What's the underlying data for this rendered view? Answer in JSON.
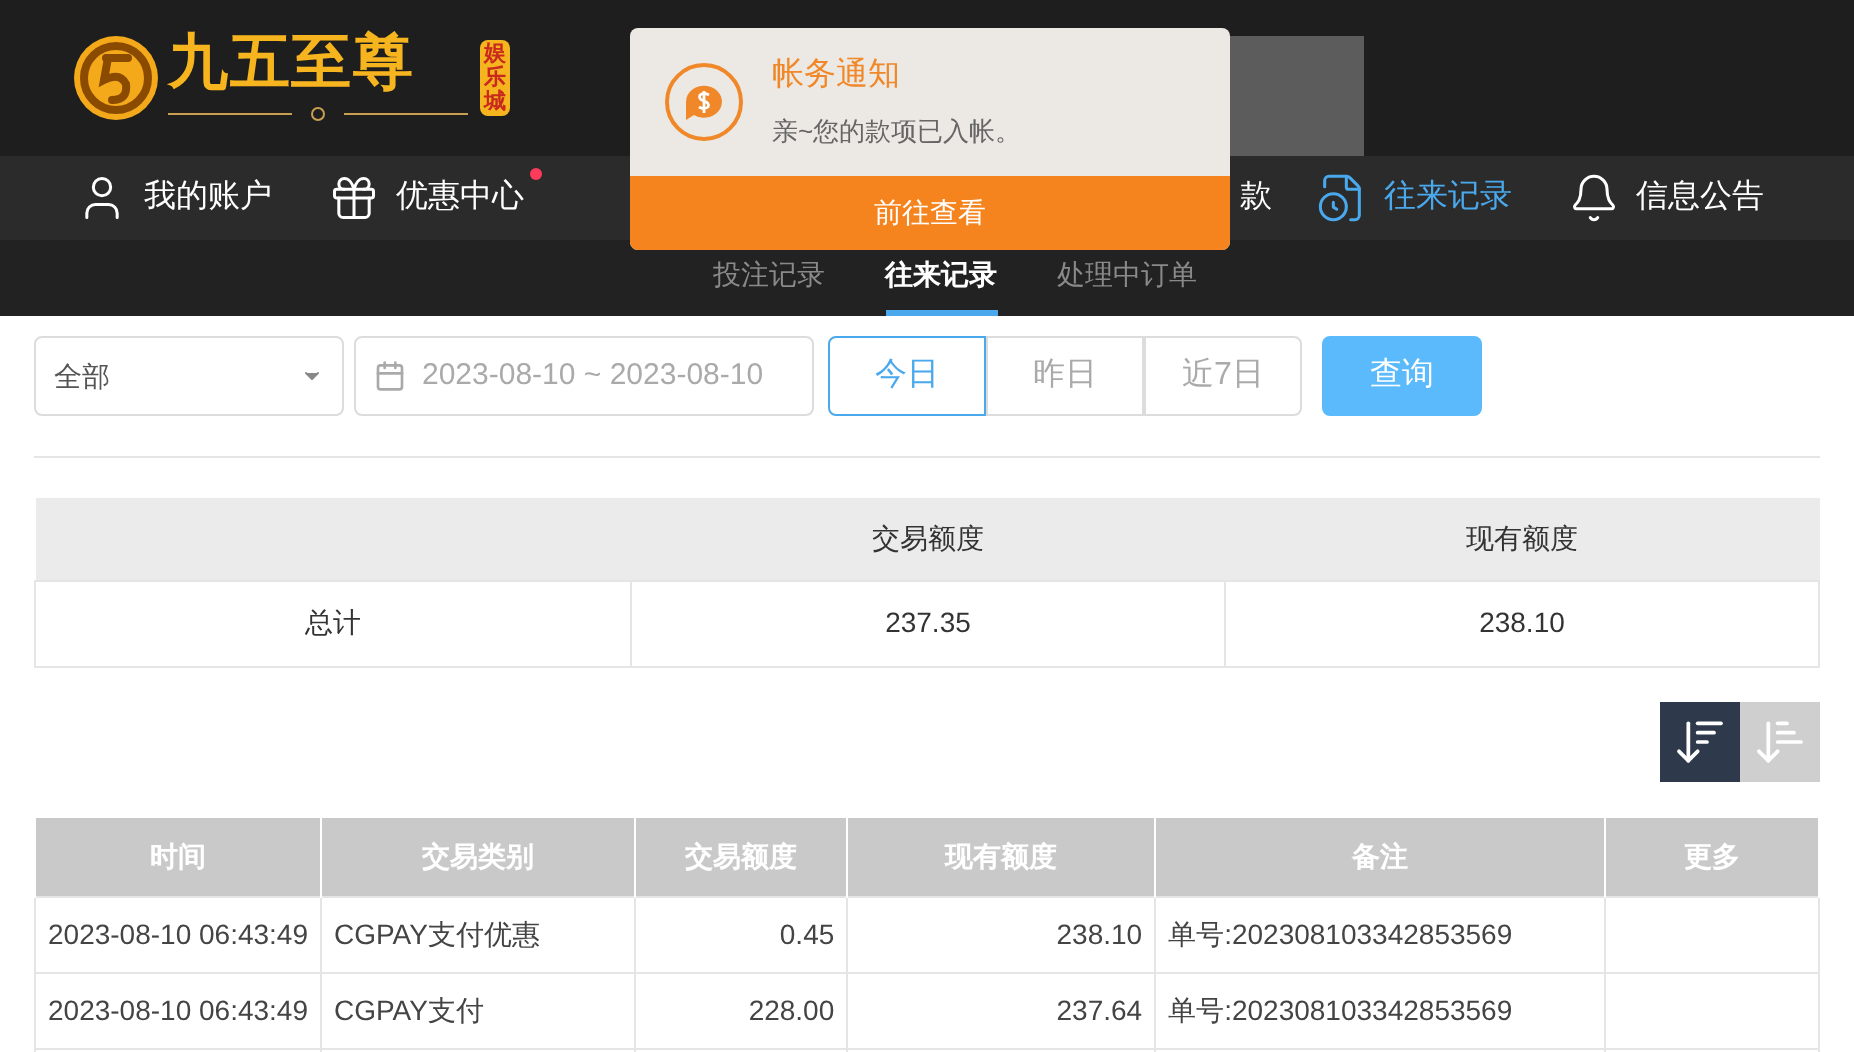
{
  "logo": {
    "name": "九五至尊",
    "badge": "娱乐城"
  },
  "toast": {
    "title": "帐务通知",
    "message": "亲~您的款项已入帐。",
    "button": "前往查看"
  },
  "nav": [
    {
      "label": "我的账户",
      "kind": "user",
      "badge": false,
      "selected": false
    },
    {
      "label": "优惠中心",
      "kind": "gift",
      "badge": true,
      "selected": false
    },
    {
      "label": "款",
      "kind": "covered",
      "badge": false,
      "selected": false
    },
    {
      "label": "往来记录",
      "kind": "record",
      "badge": false,
      "selected": true
    },
    {
      "label": "信息公告",
      "kind": "bell",
      "badge": false,
      "selected": false
    }
  ],
  "subtabs": [
    {
      "label": "投注记录",
      "selected": false
    },
    {
      "label": "往来记录",
      "selected": true
    },
    {
      "label": "处理中订单",
      "selected": false
    }
  ],
  "filter": {
    "type": "全部",
    "date_range": "2023-08-10 ~ 2023-08-10",
    "ranges": [
      {
        "label": "今日",
        "selected": true
      },
      {
        "label": "昨日",
        "selected": false
      },
      {
        "label": "近7日",
        "selected": false
      }
    ],
    "search_button": "查询"
  },
  "summary": {
    "columns": [
      "交易额度",
      "现有额度"
    ],
    "row_label": "总计",
    "values": [
      "237.35",
      "238.10"
    ]
  },
  "sort": [
    {
      "selected": true
    },
    {
      "selected": false
    }
  ],
  "table": {
    "columns": [
      "时间",
      "交易类别",
      "交易额度",
      "现有额度",
      "备注",
      "更多"
    ],
    "rows": [
      [
        "2023-08-10 06:43:49",
        "CGPAY支付优惠",
        "0.45",
        "238.10",
        "单号:202308103342853569",
        ""
      ],
      [
        "2023-08-10 06:43:49",
        "CGPAY支付",
        "228.00",
        "237.64",
        "单号:202308103342853569",
        ""
      ]
    ]
  }
}
